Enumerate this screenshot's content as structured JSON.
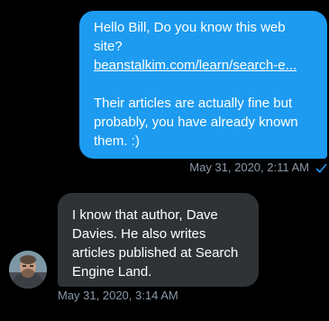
{
  "conversation": {
    "sent": {
      "line1": "Hello Bill, Do you know this web",
      "line2": "site?",
      "link": "beanstalkim.com/learn/search-e...",
      "line3": "Their articles are actually fine but",
      "line4": "probably, you have already known",
      "line5": "them. :)",
      "timestamp": "May 31, 2020, 2:11 AM",
      "status_icon": "checkmark-icon"
    },
    "received": {
      "line1": "I know that author, Dave",
      "line2": "Davies.  He also writes",
      "line3": "articles published at Search",
      "line4": "Engine Land.",
      "timestamp": "May 31, 2020, 3:14 AM",
      "avatar_icon": "avatar"
    }
  },
  "colors": {
    "background": "#000000",
    "sent_bubble": "#1d9bf0",
    "received_bubble": "#2f3336",
    "timestamp": "#8b98a5",
    "check": "#1d9bf0"
  }
}
